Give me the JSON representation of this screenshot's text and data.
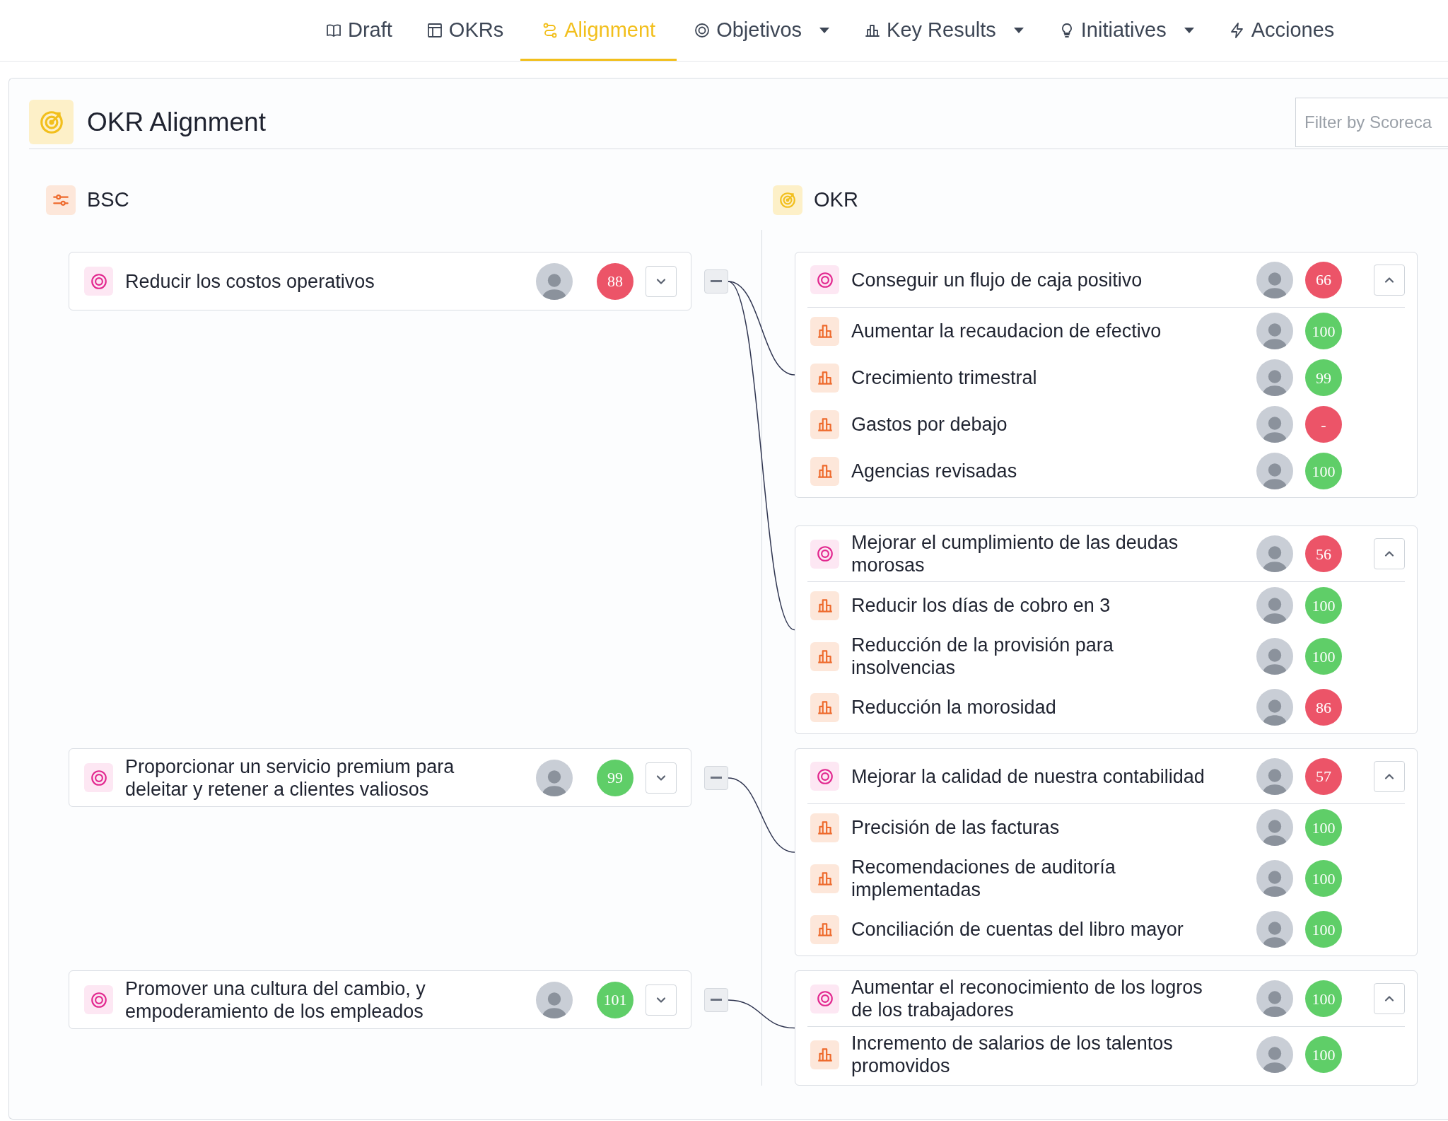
{
  "nav": [
    {
      "label": "Draft",
      "selected": false,
      "has_menu": false
    },
    {
      "label": "OKRs",
      "selected": false,
      "has_menu": false
    },
    {
      "label": "Alignment",
      "selected": true,
      "has_menu": false
    },
    {
      "label": "Objetivos",
      "selected": false,
      "has_menu": true
    },
    {
      "label": "Key Results",
      "selected": false,
      "has_menu": true
    },
    {
      "label": "Initiatives",
      "selected": false,
      "has_menu": true
    },
    {
      "label": "Acciones",
      "selected": false,
      "has_menu": false
    }
  ],
  "title": "OKR Alignment",
  "filter": {
    "placeholder": "Filter by Scoreca"
  },
  "bsc_heading": "BSC",
  "okr_heading": "OKR",
  "groups": [
    {
      "objective": {
        "title": "Reducir los costos operativos",
        "score": "88",
        "color": "#ec5468",
        "expanded": false
      },
      "okrs": [
        {
          "title": "Conseguir un flujo de caja positivo",
          "score": "66",
          "color": "#ec5468",
          "expanded": true,
          "key_results": [
            {
              "title": "Aumentar la recaudacion de efectivo",
              "score": "100",
              "color": "#5fce68"
            },
            {
              "title": "Crecimiento trimestral",
              "score": "99",
              "color": "#5fce68"
            },
            {
              "title": "Gastos por debajo",
              "score": "-",
              "color": "#ec5468"
            },
            {
              "title": "Agencias revisadas",
              "score": "100",
              "color": "#5fce68"
            }
          ]
        },
        {
          "title": "Mejorar el cumplimiento de las deudas morosas",
          "score": "56",
          "color": "#ec5468",
          "expanded": true,
          "key_results": [
            {
              "title": "Reducir los días de cobro en 3",
              "score": "100",
              "color": "#5fce68"
            },
            {
              "title": "Reducción de la provisión para insolvencias",
              "score": "100",
              "color": "#5fce68"
            },
            {
              "title": "Reducción la morosidad",
              "score": "86",
              "color": "#ec5468"
            }
          ]
        }
      ]
    },
    {
      "objective": {
        "title": "Proporcionar un servicio premium para deleitar y retener a clientes valiosos",
        "score": "99",
        "color": "#5fce68",
        "expanded": false
      },
      "okrs": [
        {
          "title": "Mejorar la calidad de nuestra contabilidad",
          "score": "57",
          "color": "#ec5468",
          "expanded": true,
          "key_results": [
            {
              "title": "Precisión de las facturas",
              "score": "100",
              "color": "#5fce68"
            },
            {
              "title": "Recomendaciones de auditoría implementadas",
              "score": "100",
              "color": "#5fce68"
            },
            {
              "title": "Conciliación de cuentas del libro mayor",
              "score": "100",
              "color": "#5fce68"
            }
          ]
        }
      ]
    },
    {
      "objective": {
        "title": "Promover una cultura del cambio, y empoderamiento de los empleados",
        "score": "101",
        "color": "#5fce68",
        "expanded": false
      },
      "okrs": [
        {
          "title": "Aumentar el reconocimiento de los logros de los trabajadores",
          "score": "100",
          "color": "#5fce68",
          "expanded": true,
          "key_results": [
            {
              "title": "Incremento de salarios de los talentos promovidos",
              "score": "100",
              "color": "#5fce68"
            }
          ]
        }
      ]
    }
  ]
}
